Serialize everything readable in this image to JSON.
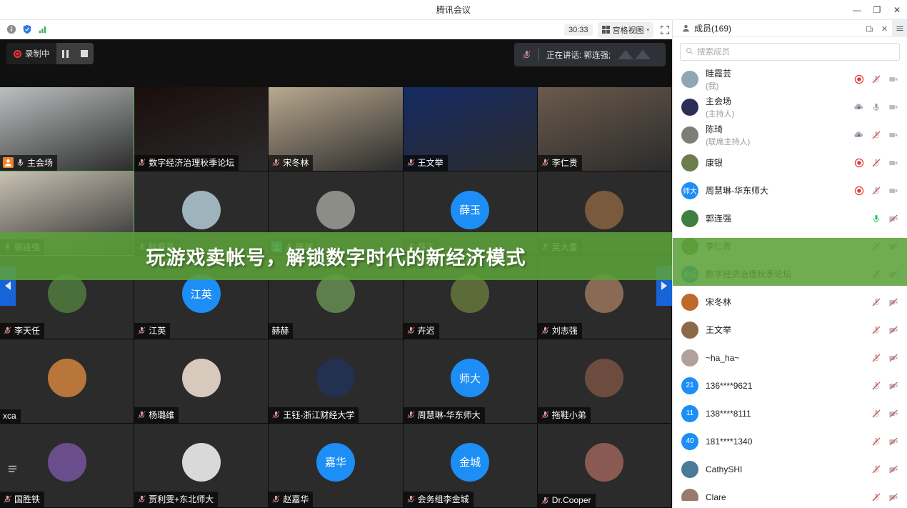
{
  "window": {
    "title": "腾讯会议",
    "minimize": "—",
    "maximize": "❐",
    "close": "✕"
  },
  "toolbar": {
    "info_icon": "info-icon",
    "shield_icon": "shield-icon",
    "network_icon": "network-signal-icon",
    "timer": "30:33",
    "view_mode": "宫格视图",
    "view_caret": "▾",
    "fullscreen_icon": "fullscreen-icon",
    "sidebar_icon": "sidebar-toggle-icon"
  },
  "stage": {
    "recording_label": "录制中",
    "pause_label": "pause-recording",
    "stop_label": "stop-recording",
    "speaking_label": "正在讲话: 郭连强;",
    "nav_prev": "◀",
    "nav_next": "▶",
    "banner_text": "玩游戏卖帐号，解锁数字时代的新经济模式",
    "more_icon": "more-options-icon"
  },
  "grid": {
    "tiles": [
      {
        "name": "主会场",
        "host": true,
        "mic": "on",
        "speaking": true,
        "kind": "video",
        "bg": "#bcbfc0",
        "initials": ""
      },
      {
        "name": "数字经济治理秋季论坛",
        "host": false,
        "mic": "off",
        "speaking": false,
        "kind": "video",
        "bg": "#1a0d0c",
        "initials": ""
      },
      {
        "name": "宋冬林",
        "host": false,
        "mic": "off",
        "speaking": false,
        "kind": "video",
        "bg": "#b9a98f",
        "initials": ""
      },
      {
        "name": "王文举",
        "host": false,
        "mic": "off",
        "speaking": false,
        "kind": "video",
        "bg": "#142a63",
        "initials": ""
      },
      {
        "name": "李仁贵",
        "host": false,
        "mic": "off",
        "speaking": false,
        "kind": "video",
        "bg": "#6a5a4c",
        "initials": ""
      },
      {
        "name": "郭连强",
        "host": false,
        "mic": "on",
        "speaking": true,
        "kind": "video",
        "bg": "#c9c2b4",
        "initials": ""
      },
      {
        "name": "眭霞芸",
        "host": false,
        "mic": "off",
        "speaking": false,
        "kind": "avatar",
        "bg": "#9fb3bd",
        "initials": ""
      },
      {
        "name": "陈琦",
        "host": true,
        "mic": "off",
        "speaking": false,
        "kind": "avatar",
        "bg": "#8c8d87",
        "initials": ""
      },
      {
        "name": "薛玉",
        "host": false,
        "mic": "off",
        "speaking": false,
        "kind": "avatar",
        "bg": "#1c8ef5",
        "initials": "薛玉"
      },
      {
        "name": "吴大蕾",
        "host": false,
        "mic": "off",
        "speaking": false,
        "kind": "avatar",
        "bg": "#7a5a3c",
        "initials": ""
      },
      {
        "name": "李天任",
        "host": false,
        "mic": "off",
        "speaking": false,
        "kind": "avatar",
        "bg": "#4a6f3a",
        "initials": ""
      },
      {
        "name": "江英",
        "host": false,
        "mic": "off",
        "speaking": false,
        "kind": "avatar",
        "bg": "#1c8ef5",
        "initials": "江英"
      },
      {
        "name": "赫赫",
        "host": false,
        "mic": "none",
        "speaking": false,
        "kind": "avatar",
        "bg": "#5d7f4e",
        "initials": ""
      },
      {
        "name": "卉迟",
        "host": false,
        "mic": "off",
        "speaking": false,
        "kind": "avatar",
        "bg": "#5c6b3a",
        "initials": ""
      },
      {
        "name": "刘志强",
        "host": false,
        "mic": "off",
        "speaking": false,
        "kind": "avatar",
        "bg": "#8a6a55",
        "initials": ""
      },
      {
        "name": "xca",
        "host": false,
        "mic": "none",
        "speaking": false,
        "kind": "avatar",
        "bg": "#b8763a",
        "initials": ""
      },
      {
        "name": "杨璐维",
        "host": false,
        "mic": "off",
        "speaking": false,
        "kind": "avatar",
        "bg": "#d8c9bd",
        "initials": ""
      },
      {
        "name": "王钰-浙江财经大学",
        "host": false,
        "mic": "off",
        "speaking": false,
        "kind": "avatar",
        "bg": "#23304f",
        "initials": ""
      },
      {
        "name": "周慧琳-华东师大",
        "host": false,
        "mic": "off",
        "speaking": false,
        "kind": "avatar",
        "bg": "#1c8ef5",
        "initials": "师大"
      },
      {
        "name": "拖鞋小弟",
        "host": false,
        "mic": "off",
        "speaking": false,
        "kind": "avatar",
        "bg": "#6d4c3f",
        "initials": ""
      },
      {
        "name": "国胜铁",
        "host": false,
        "mic": "off",
        "speaking": false,
        "kind": "avatar",
        "bg": "#6a4e8c",
        "initials": ""
      },
      {
        "name": "贾利雯+东北师大",
        "host": false,
        "mic": "off",
        "speaking": false,
        "kind": "avatar",
        "bg": "#d9d9d9",
        "initials": ""
      },
      {
        "name": "赵嘉华",
        "host": false,
        "mic": "off",
        "speaking": false,
        "kind": "avatar",
        "bg": "#1c8ef5",
        "initials": "嘉华"
      },
      {
        "name": "会务组李金城",
        "host": false,
        "mic": "off",
        "speaking": false,
        "kind": "avatar",
        "bg": "#1c8ef5",
        "initials": "金城"
      },
      {
        "name": "Dr.Cooper",
        "host": false,
        "mic": "off",
        "speaking": false,
        "kind": "avatar",
        "bg": "#8a5a52",
        "initials": ""
      }
    ]
  },
  "panel": {
    "title": "成员(169)",
    "person_icon": "person-icon",
    "popout_icon": "popout-icon",
    "close_icon": "close-icon",
    "menu_icon": "hamburger-menu-icon",
    "search_placeholder": "搜索成员",
    "search_value": "",
    "participants": [
      {
        "name": "眭霞芸",
        "role": "(我)",
        "avatar_bg": "#8fa7b5",
        "initials": "",
        "rec": "red",
        "mic": "off",
        "cam": "off"
      },
      {
        "name": "主会场",
        "role": "(主持人)",
        "avatar_bg": "#2b2f55",
        "initials": "",
        "rec": "cloud",
        "mic": "on",
        "cam": "off"
      },
      {
        "name": "陈琦",
        "role": "(联席主持人)",
        "avatar_bg": "#7d7e78",
        "initials": "",
        "rec": "cloud",
        "mic": "off",
        "cam": "off"
      },
      {
        "name": "康银",
        "role": "",
        "avatar_bg": "#6e7d4e",
        "initials": "",
        "rec": "red",
        "mic": "off",
        "cam": "off"
      },
      {
        "name": "周慧琳-华东师大",
        "role": "",
        "avatar_bg": "#1c8ef5",
        "initials": "师大",
        "rec": "red",
        "mic": "off",
        "cam": "off"
      },
      {
        "name": "郭连强",
        "role": "",
        "avatar_bg": "#3f7f3f",
        "initials": "",
        "rec": "",
        "mic": "green",
        "cam": "off"
      },
      {
        "name": "李仁贵",
        "role": "",
        "avatar_bg": "#5c8a4a",
        "initials": "",
        "rec": "",
        "mic": "off",
        "cam": "off"
      },
      {
        "name": "数字经济治理秋季论坛",
        "role": "",
        "avatar_bg": "#1c8ef5",
        "initials": "论坛",
        "rec": "",
        "mic": "off",
        "cam": "off"
      },
      {
        "name": "宋冬林",
        "role": "",
        "avatar_bg": "#c06a2a",
        "initials": "",
        "rec": "",
        "mic": "off",
        "cam": "off"
      },
      {
        "name": "王文举",
        "role": "",
        "avatar_bg": "#8a6a4a",
        "initials": "",
        "rec": "",
        "mic": "off",
        "cam": "off"
      },
      {
        "name": "~ha_ha~",
        "role": "",
        "avatar_bg": "#b0a29b",
        "initials": "",
        "rec": "",
        "mic": "off",
        "cam": "off"
      },
      {
        "name": "136****9621",
        "role": "",
        "avatar_bg": "#1c8ef5",
        "initials": "21",
        "rec": "",
        "mic": "off",
        "cam": "off"
      },
      {
        "name": "138****8111",
        "role": "",
        "avatar_bg": "#1c8ef5",
        "initials": "11",
        "rec": "",
        "mic": "off",
        "cam": "off"
      },
      {
        "name": "181****1340",
        "role": "",
        "avatar_bg": "#1c8ef5",
        "initials": "40",
        "rec": "",
        "mic": "off",
        "cam": "off"
      },
      {
        "name": "CathySHI",
        "role": "",
        "avatar_bg": "#4a7a9a",
        "initials": "",
        "rec": "",
        "mic": "off",
        "cam": "off"
      },
      {
        "name": "Clare",
        "role": "",
        "avatar_bg": "#9a7a6a",
        "initials": "",
        "rec": "",
        "mic": "off",
        "cam": "off"
      }
    ]
  },
  "colors": {
    "accent_blue": "#1c8ef5",
    "banner_green": "#5ca03a",
    "record_red": "#e33333",
    "mic_green": "#22c55e"
  }
}
